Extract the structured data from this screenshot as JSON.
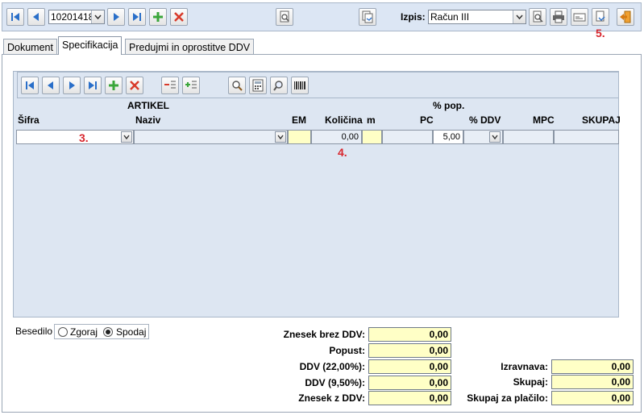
{
  "toolbar": {
    "document_number": "10201418",
    "print_label": "Izpis:",
    "print_option": "Račun III"
  },
  "annotations": {
    "a3": "3.",
    "a4": "4.",
    "a5": "5."
  },
  "tabs": [
    {
      "label": "Dokument",
      "active": false
    },
    {
      "label": "Specifikacija",
      "active": true
    },
    {
      "label": "Predujmi in oprostitve DDV",
      "active": false
    }
  ],
  "grid": {
    "group_artikel": "ARTIKEL",
    "group_pop": "% pop.",
    "columns": {
      "sifra": "Šifra",
      "naziv": "Naziv",
      "em": "EM",
      "kolicina": "Količina",
      "m": "m",
      "pc": "PC",
      "ddv": "% DDV",
      "mpc": "MPC",
      "skupaj": "SKUPAJ"
    },
    "row": {
      "kolicina": "0,00",
      "pop": "5,00"
    }
  },
  "besedilo": {
    "label": "Besedilo",
    "options": [
      "Zgoraj",
      "Spodaj"
    ],
    "selected": "Spodaj"
  },
  "totals": {
    "znesek_brez_ddv_label": "Znesek brez DDV:",
    "znesek_brez_ddv": "0,00",
    "popust_label": "Popust:",
    "popust": "0,00",
    "ddv22_label": "DDV (22,00%):",
    "ddv22": "0,00",
    "ddv95_label": "DDV (9,50%):",
    "ddv95": "0,00",
    "znesek_z_ddv_label": "Znesek z DDV:",
    "znesek_z_ddv": "0,00",
    "izravnava_label": "Izravnava:",
    "izravnava": "0,00",
    "skupaj_label": "Skupaj:",
    "skupaj": "0,00",
    "skupaj_placilo_label": "Skupaj za plačilo:",
    "skupaj_placilo": "0,00"
  },
  "colors": {
    "accent_blue": "#2a6fc9",
    "add_green": "#3aa63a",
    "delete_red": "#d83a2a",
    "annotation_red": "#d8262d",
    "field_yellow": "#ffffc6"
  }
}
